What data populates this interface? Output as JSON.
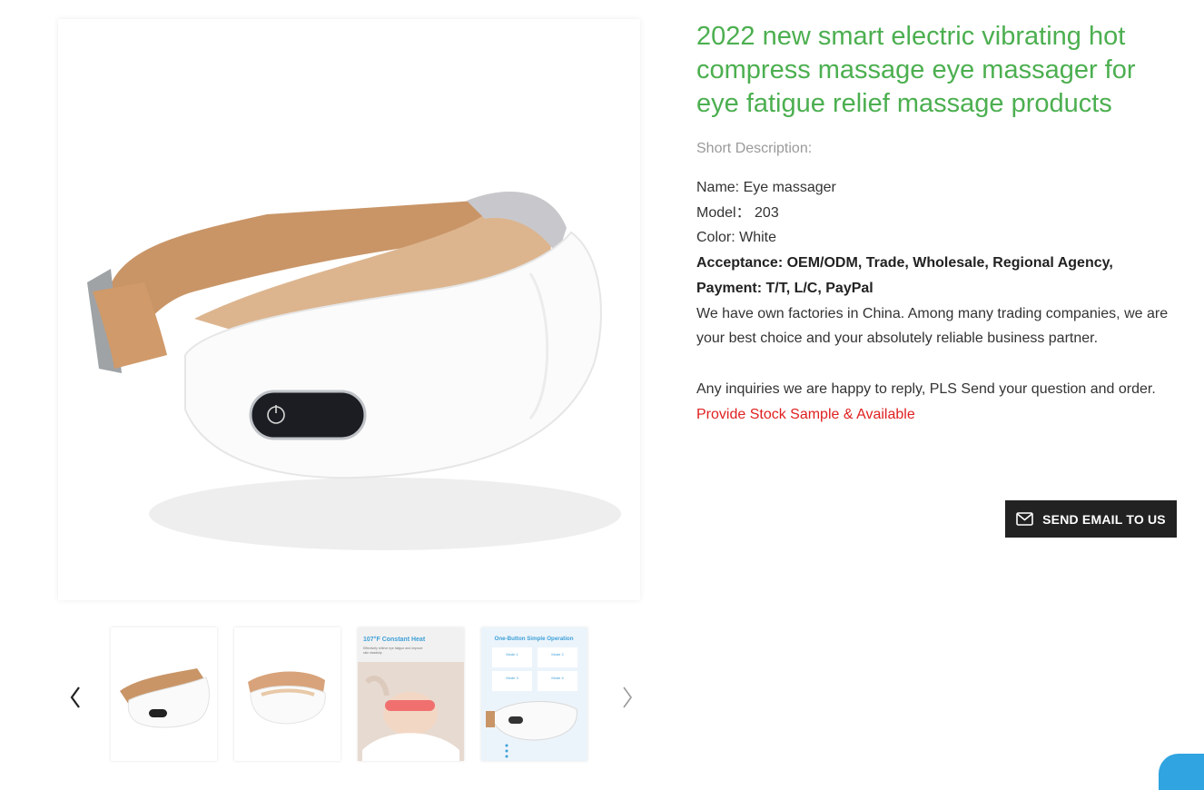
{
  "product": {
    "title": "2022 new smart electric vibrating hot compress massage eye massager for eye fatigue relief massage products",
    "short_description_label": "Short Description:",
    "details": {
      "name": "Name: Eye massager",
      "model": "Model：  203",
      "color": "Color: White",
      "acceptance": "Acceptance: OEM/ODM, Trade, Wholesale, Regional Agency,",
      "payment": "Payment: T/T, L/C, PayPal",
      "factories": "We have own factories in China. Among many trading companies, we are your best choice and your absolutely reliable business partner.",
      "inquiries": "Any inquiries we are happy to reply, PLS Send your question and order.",
      "stock": "Provide Stock Sample & Available"
    },
    "send_email_label": "SEND EMAIL TO US"
  },
  "gallery": {
    "main_image": "eye-massager-front",
    "thumbnails": [
      {
        "image": "eye-massager-front"
      },
      {
        "image": "eye-massager-back"
      },
      {
        "image": "constant-heat-banner",
        "heading": "107°F Constant Heat",
        "caption": "Effectively relieve eye fatigue and improve skin elasticity"
      },
      {
        "image": "one-button-operation-banner",
        "heading": "One-Button Simple Operation",
        "modes": [
          "Mode 1",
          "Mode 2",
          "Mode 3",
          "Mode 4"
        ]
      }
    ],
    "prev_icon": "chevron-left-icon",
    "next_icon": "chevron-right-icon"
  },
  "colors": {
    "title_green": "#4caf50",
    "stock_red": "#e02020",
    "button_bg": "#222222",
    "chat_blue": "#2fa4e0"
  }
}
